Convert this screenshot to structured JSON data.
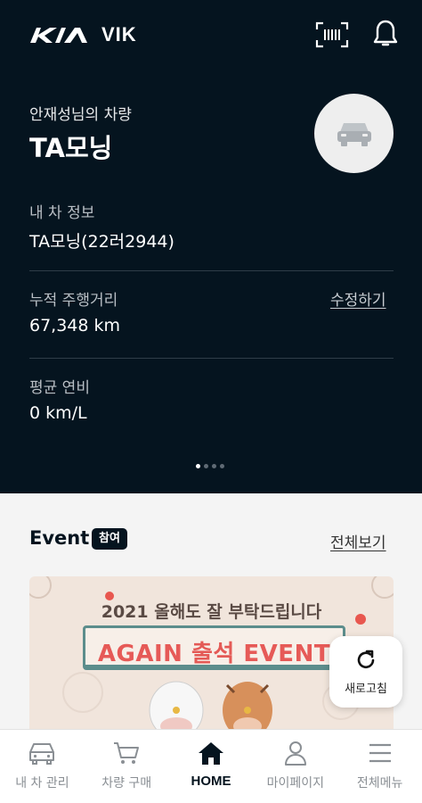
{
  "header": {
    "app_name": "VIK",
    "icons": [
      "kia-logo-icon",
      "barcode-scan-icon",
      "bell-icon"
    ]
  },
  "vehicle": {
    "owner_label": "안재성님의 차량",
    "car_name": "TA모닝",
    "info_title": "내 차 정보",
    "info_value": "TA모닝(22러2944)",
    "mileage_title": "누적 주행거리",
    "mileage_value": "67,348 km",
    "edit_label": "수정하기",
    "efficiency_title": "평균 연비",
    "efficiency_value": "0 km/L",
    "carousel": {
      "pages": 4,
      "active": 0
    }
  },
  "event": {
    "title": "Event",
    "badge": "참여",
    "view_all": "전체보기",
    "banner_subtitle": "2021 올해도 잘 부탁드립니다",
    "banner_left": "AGAIN",
    "banner_mid": "출석",
    "banner_right": "EVENT"
  },
  "refresh": {
    "label": "새로고침"
  },
  "tabs": [
    {
      "label": "내 차 관리",
      "icon": "car-icon"
    },
    {
      "label": "차량 구매",
      "icon": "cart-icon"
    },
    {
      "label": "HOME",
      "icon": "home-icon",
      "active": true
    },
    {
      "label": "마이페이지",
      "icon": "person-icon"
    },
    {
      "label": "전체메뉴",
      "icon": "menu-icon"
    }
  ],
  "colors": {
    "hero_bg": "#05141f",
    "page_bg": "#f4f4f4",
    "banner_accent": "#e65a57",
    "banner_teal": "#5c8d8c"
  }
}
